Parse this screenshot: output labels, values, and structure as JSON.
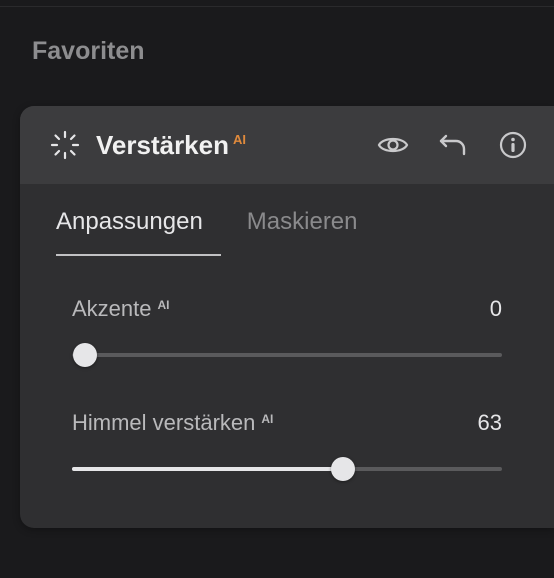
{
  "favorites_label": "Favoriten",
  "panel": {
    "title": "Verstärken",
    "ai_badge": "AI",
    "icons": {
      "enhance": "enhance",
      "eye": "eye",
      "undo": "undo",
      "info": "info"
    }
  },
  "tabs": [
    {
      "id": "adjustments",
      "label": "Anpassungen",
      "active": true
    },
    {
      "id": "masking",
      "label": "Maskieren",
      "active": false
    }
  ],
  "sliders": [
    {
      "id": "accents",
      "label": "Akzente",
      "ai": true,
      "value": 0,
      "min": 0,
      "max": 100
    },
    {
      "id": "sky_enhance",
      "label": "Himmel verstärken",
      "ai": true,
      "value": 63,
      "min": 0,
      "max": 100
    }
  ],
  "colors": {
    "accent": "#e08a3c",
    "panel_bg": "#2f2f31",
    "header_bg": "#3c3c3e"
  }
}
